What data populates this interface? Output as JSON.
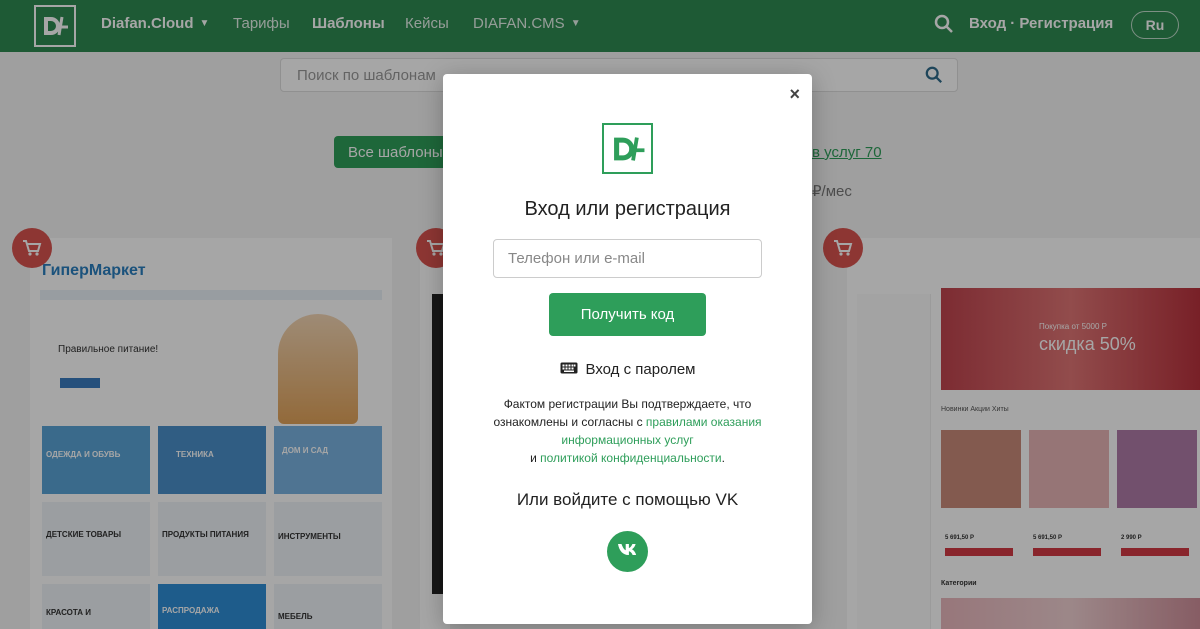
{
  "nav": {
    "brand": "Diafan.Cloud",
    "tariffs": "Тарифы",
    "templates": "Шаблоны",
    "cases": "Кейсы",
    "cms": "DIAFAN.CMS",
    "login": "Вход · Регистрация",
    "lang": "Ru"
  },
  "page": {
    "search_placeholder": "Поиск по шаблонам",
    "all_templates": "Все шаблоны",
    "link_text": "в услуг 70",
    "price_text": "₽/мес"
  },
  "cards": {
    "card1_brand": "ГиперМаркет",
    "card1_promo": "Правильное питание!",
    "card1_tiles": [
      "ОДЕЖДА И ОБУВЬ",
      "ТЕХНИКА",
      "ДОМ И САД",
      "ДЕТСКИЕ ТОВАРЫ",
      "ПРОДУКТЫ ПИТАНИЯ",
      "ИНСТРУМЕНТЫ",
      "КРАСОТА И",
      "РАСПРОДАЖА",
      "МЕБЕЛЬ"
    ],
    "card3_promo": "Покупка от 5000 Р",
    "card3_discount": "скидка 50%",
    "card3_tabs": "Новинки   Акции   Хиты",
    "card3_prices": [
      "5 691,50 Р",
      "5 691,50 Р",
      "2 990 Р"
    ],
    "card3_categories": "Категории"
  },
  "modal": {
    "title": "Вход или регистрация",
    "input_placeholder": "Телефон или e-mail",
    "get_code": "Получить код",
    "password_login": "Вход с паролем",
    "terms_text_1": "Фактом регистрации Вы подтверждаете, что ознакомлены и согласны с",
    "terms_link_1": "правилами оказания информационных услуг",
    "terms_and": "и",
    "terms_link_2": "политикой конфиденциальности",
    "terms_dot": ".",
    "vk_title": "Или войдите с помощью VK",
    "close": "×"
  },
  "colors": {
    "nav_bg": "#2e8b52",
    "accent": "#2e9e5a",
    "cart": "#d9534f"
  },
  "icons": {
    "logo": "df-logo-icon",
    "search": "search-icon",
    "keyboard": "keyboard-icon",
    "vk": "vk-icon",
    "close": "close-icon",
    "cart": "cart-icon"
  }
}
